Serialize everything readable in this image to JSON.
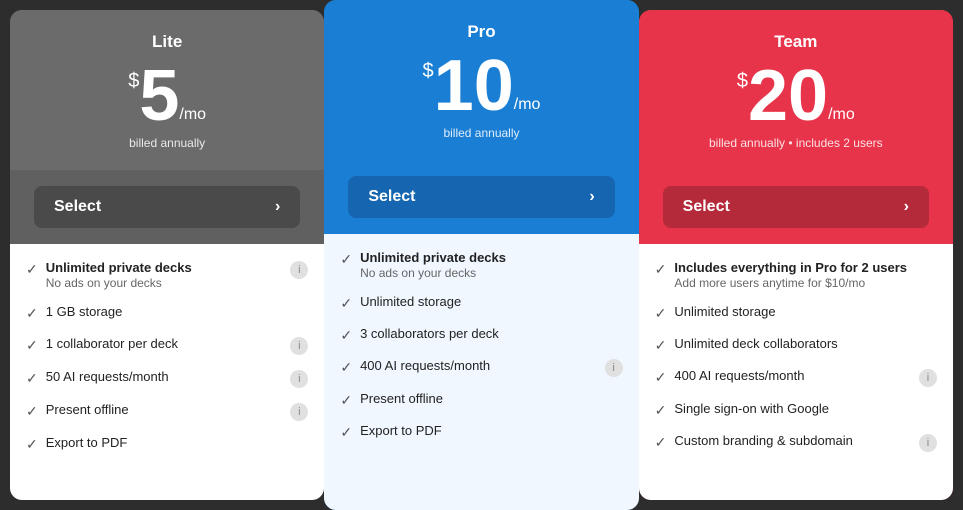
{
  "plans": [
    {
      "id": "lite",
      "name": "Lite",
      "price": "5",
      "period": "/mo",
      "billing": "billed annually",
      "select_label": "Select",
      "features": [
        {
          "label": "Unlimited private decks",
          "sublabel": "No ads on your decks",
          "bold": true,
          "has_info": true
        },
        {
          "label": "1 GB storage",
          "sublabel": "",
          "bold": false,
          "has_info": false
        },
        {
          "label": "1 collaborator per deck",
          "sublabel": "",
          "bold": false,
          "has_info": true
        },
        {
          "label": "50 AI requests/month",
          "sublabel": "",
          "bold": false,
          "has_info": true
        },
        {
          "label": "Present offline",
          "sublabel": "",
          "bold": false,
          "has_info": true
        },
        {
          "label": "Export to PDF",
          "sublabel": "",
          "bold": false,
          "has_info": false
        }
      ]
    },
    {
      "id": "pro",
      "name": "Pro",
      "price": "10",
      "period": "/mo",
      "billing": "billed annually",
      "select_label": "Select",
      "features": [
        {
          "label": "Unlimited private decks",
          "sublabel": "No ads on your decks",
          "bold": true,
          "has_info": false
        },
        {
          "label": "Unlimited storage",
          "sublabel": "",
          "bold": false,
          "has_info": false
        },
        {
          "label": "3 collaborators per deck",
          "sublabel": "",
          "bold": false,
          "has_info": false
        },
        {
          "label": "400 AI requests/month",
          "sublabel": "",
          "bold": false,
          "has_info": true
        },
        {
          "label": "Present offline",
          "sublabel": "",
          "bold": false,
          "has_info": false
        },
        {
          "label": "Export to PDF",
          "sublabel": "",
          "bold": false,
          "has_info": false
        }
      ]
    },
    {
      "id": "team",
      "name": "Team",
      "price": "20",
      "period": "/mo",
      "billing": "billed annually • includes 2 users",
      "select_label": "Select",
      "features": [
        {
          "label": "Includes everything in Pro for 2 users",
          "sublabel": "Add more users anytime for $10/mo",
          "bold": true,
          "has_info": false
        },
        {
          "label": "Unlimited storage",
          "sublabel": "",
          "bold": false,
          "has_info": false
        },
        {
          "label": "Unlimited deck collaborators",
          "sublabel": "",
          "bold": false,
          "has_info": false
        },
        {
          "label": "400 AI requests/month",
          "sublabel": "",
          "bold": false,
          "has_info": true
        },
        {
          "label": "Single sign-on with Google",
          "sublabel": "",
          "bold": false,
          "has_info": false
        },
        {
          "label": "Custom branding & subdomain",
          "sublabel": "",
          "bold": false,
          "has_info": true
        }
      ]
    }
  ],
  "check_symbol": "✓",
  "info_symbol": "i",
  "arrow_symbol": "›"
}
